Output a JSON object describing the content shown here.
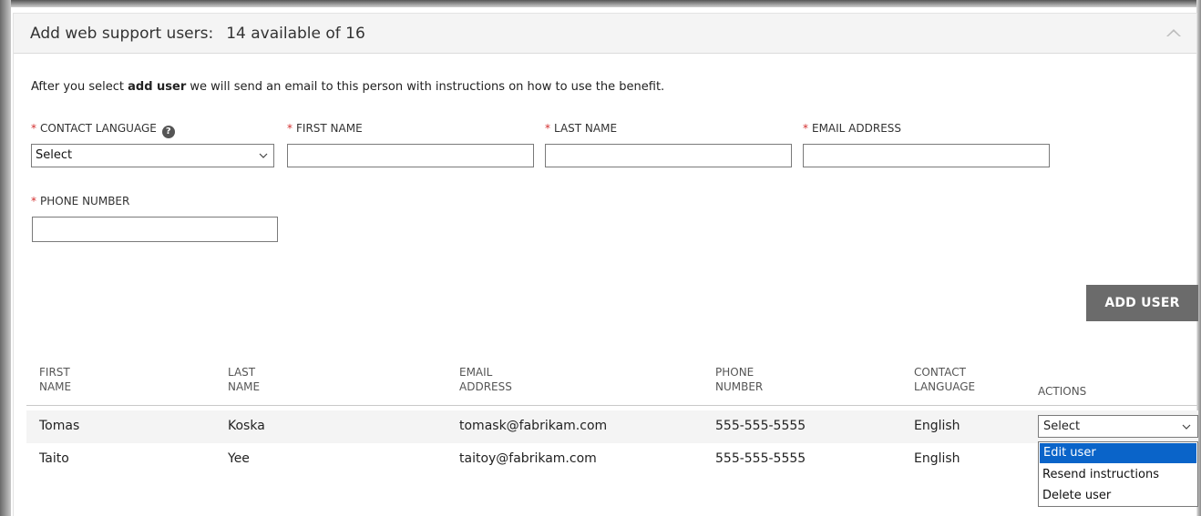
{
  "header": {
    "title": "Add web support users:",
    "count": "14 available of 16"
  },
  "intro": {
    "prefix": "After you select ",
    "bold": "add user",
    "suffix": " we will send an email to this person with instructions on how to use the benefit."
  },
  "form": {
    "required_mark": "*",
    "contact_language": {
      "label": "CONTACT LANGUAGE",
      "value": "Select"
    },
    "first_name": {
      "label": "FIRST NAME",
      "value": ""
    },
    "last_name": {
      "label": "LAST NAME",
      "value": ""
    },
    "email": {
      "label": "EMAIL ADDRESS",
      "value": ""
    },
    "phone": {
      "label": "PHONE NUMBER",
      "value": ""
    },
    "help_glyph": "?",
    "add_button": "ADD USER"
  },
  "table": {
    "columns": [
      [
        "FIRST",
        "NAME"
      ],
      [
        "LAST",
        "NAME"
      ],
      [
        "EMAIL",
        "ADDRESS"
      ],
      [
        "PHONE",
        "NUMBER"
      ],
      [
        "CONTACT",
        "LANGUAGE"
      ],
      [
        "",
        "ACTIONS"
      ]
    ],
    "rows": [
      {
        "first": "Tomas",
        "last": "Koska",
        "email": "tomask@fabrikam.com",
        "phone": "555-555-5555",
        "language": "English"
      },
      {
        "first": "Taito",
        "last": "Yee",
        "email": "taitoy@fabrikam.com",
        "phone": "555-555-5555",
        "language": "English"
      }
    ],
    "actions_select": {
      "value": "Select",
      "options": [
        "Edit user",
        "Resend instructions",
        "Delete user"
      ]
    }
  },
  "icons": {
    "collapse": "chevron-up-icon",
    "help": "help-icon",
    "dropdown": "chevron-down-icon"
  },
  "colors": {
    "required": "#d32f2f",
    "button": "#6b6b6b",
    "highlight": "#0a64c9",
    "header_bg": "#f4f4f4"
  }
}
